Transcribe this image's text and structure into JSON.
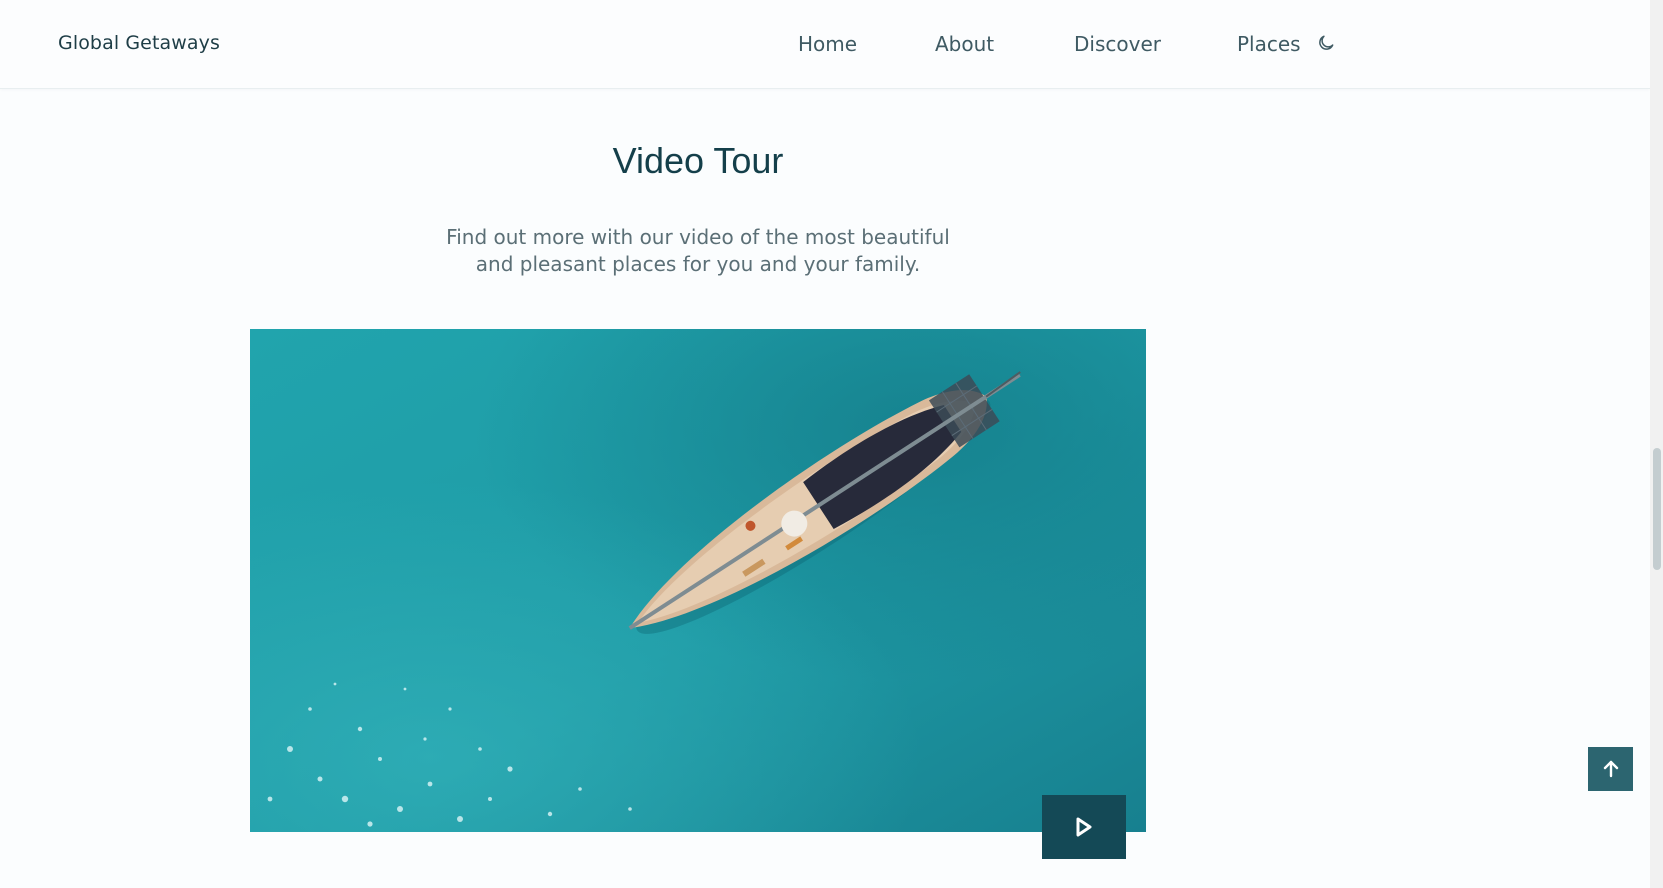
{
  "header": {
    "logo": "Global Getaways",
    "nav": [
      {
        "label": "Home"
      },
      {
        "label": "About"
      },
      {
        "label": "Discover"
      },
      {
        "label": "Places"
      }
    ],
    "theme_icon": "moon-icon"
  },
  "video_section": {
    "title": "Video Tour",
    "description": "Find out more with our video of the most beautiful and pleasant places for you and your family.",
    "play_icon": "play-icon"
  },
  "scroll_up_icon": "arrow-up-icon",
  "colors": {
    "brand_dark": "#144956",
    "scroll_button": "#2c6570",
    "water": "#1f9aa6"
  }
}
